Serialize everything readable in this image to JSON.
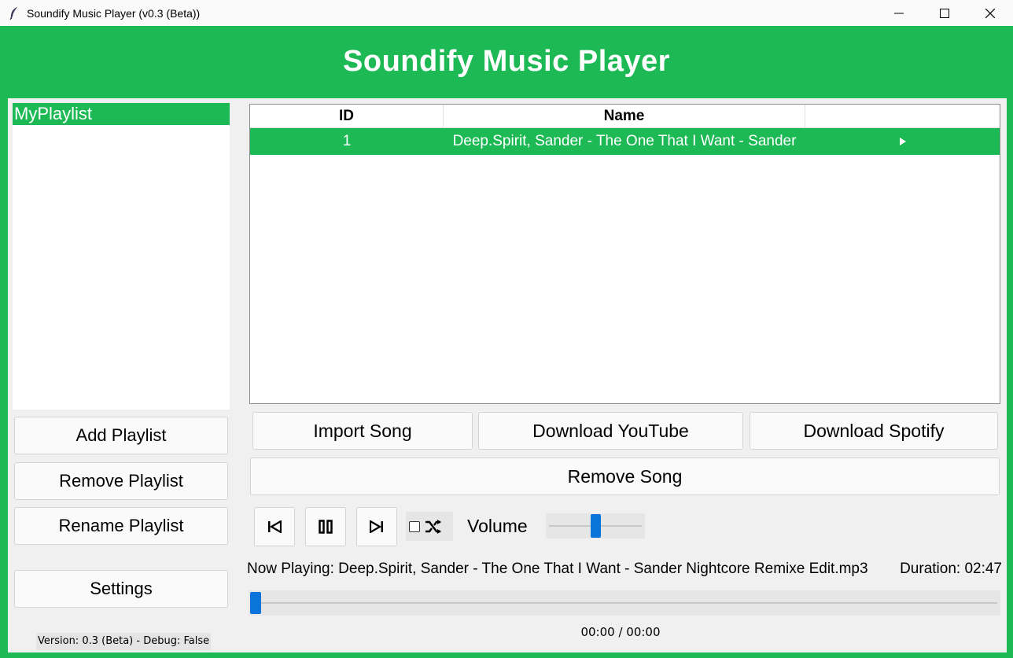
{
  "window": {
    "title": "Soundify Music Player (v0.3 (Beta))",
    "controls": [
      "minimize-icon",
      "maximize-icon",
      "close-icon"
    ]
  },
  "header": {
    "title": "Soundify Music Player"
  },
  "sidebar": {
    "playlists": [
      {
        "label": "MyPlaylist",
        "selected": true
      }
    ],
    "buttons": {
      "add": "Add Playlist",
      "remove": "Remove Playlist",
      "rename": "Rename Playlist",
      "settings": "Settings"
    },
    "version": "Version: 0.3 (Beta) - Debug: False"
  },
  "songs_table": {
    "columns": [
      "ID",
      "Name",
      ""
    ],
    "rows": [
      {
        "id": "1",
        "name": "Deep.Spirit, Sander - The One That I Want - Sander",
        "selected": true,
        "icon": "play-triangle-icon"
      }
    ]
  },
  "actions": {
    "import": "Import Song",
    "youtube": "Download YouTube",
    "spotify": "Download Spotify",
    "remove": "Remove Song"
  },
  "player": {
    "controls": [
      "previous-icon",
      "pause-icon",
      "next-icon",
      "shuffle-icon"
    ],
    "shuffle_checked": false,
    "volume_label": "Volume",
    "volume_level": 0.5,
    "now_playing": "Now Playing: Deep.Spirit, Sander - The One That I Want - Sander Nightcore Remixe Edit.mp3",
    "duration": "Duration: 02:47",
    "progress": 0.0,
    "time": "00:00 / 00:00"
  },
  "colors": {
    "accent": "#1db954",
    "slider": "#0a74da",
    "panel": "#f0f0f0"
  }
}
